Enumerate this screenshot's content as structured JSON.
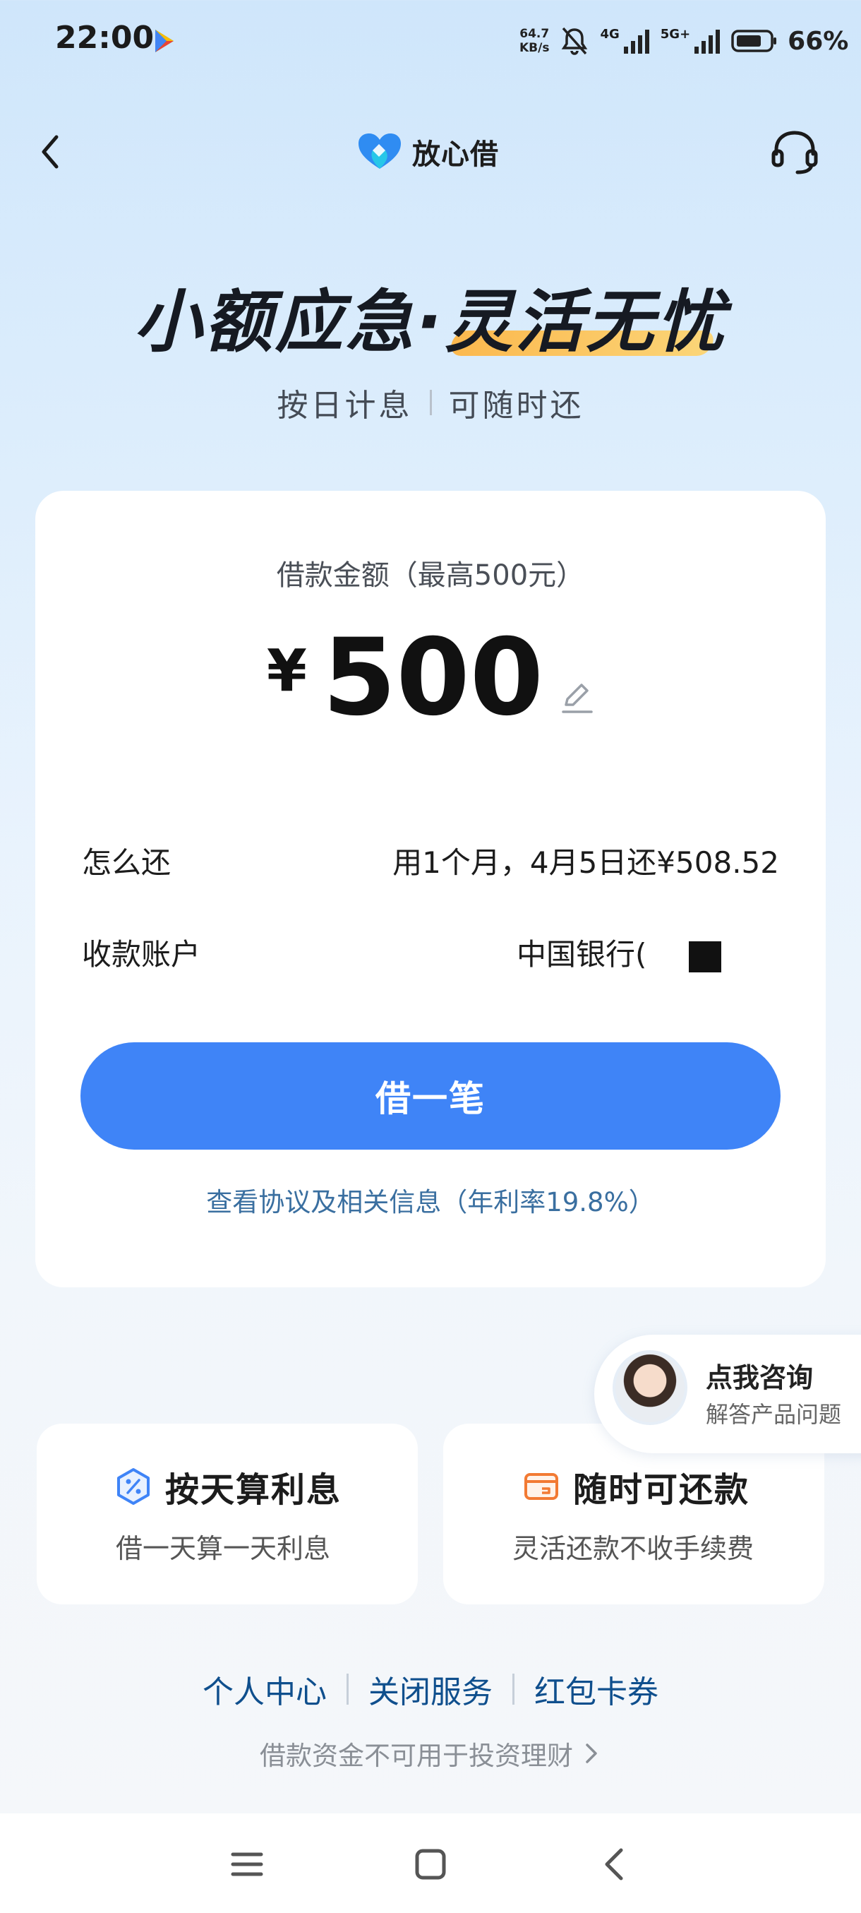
{
  "status_bar": {
    "time": "22:00",
    "net_speed_value": "64.7",
    "net_speed_unit": "KB/s",
    "signal_1": "4G",
    "signal_2": "5G+",
    "battery": "66%"
  },
  "nav": {
    "brand_name": "放心借"
  },
  "hero": {
    "title": "小额应急·灵活无忧",
    "sub_left": "按日计息",
    "sub_right": "可随时还"
  },
  "loan": {
    "amount_label": "借款金额（最高500元）",
    "currency": "¥",
    "amount": "500",
    "repay_label": "怎么还",
    "repay_value": "用1个月，4月5日还¥508.52",
    "account_label": "收款账户",
    "account_value": "中国银行(",
    "borrow_button": "借一笔",
    "agreement_link": "查看协议及相关信息（年利率19.8%）"
  },
  "consult": {
    "title": "点我咨询",
    "subtitle": "解答产品问题"
  },
  "features": [
    {
      "title": "按天算利息",
      "subtitle": "借一天算一天利息",
      "icon": "percent-icon"
    },
    {
      "title": "随时可还款",
      "subtitle": "灵活还款不收手续费",
      "icon": "wallet-icon"
    }
  ],
  "bottom_links": [
    "个人中心",
    "关闭服务",
    "红包卡券"
  ],
  "disclaimer": "借款资金不可用于投资理财",
  "colors": {
    "primary": "#3f84f7",
    "link": "#0f4f8d",
    "highlight": "#ffb23a",
    "card": "#ffffff"
  }
}
